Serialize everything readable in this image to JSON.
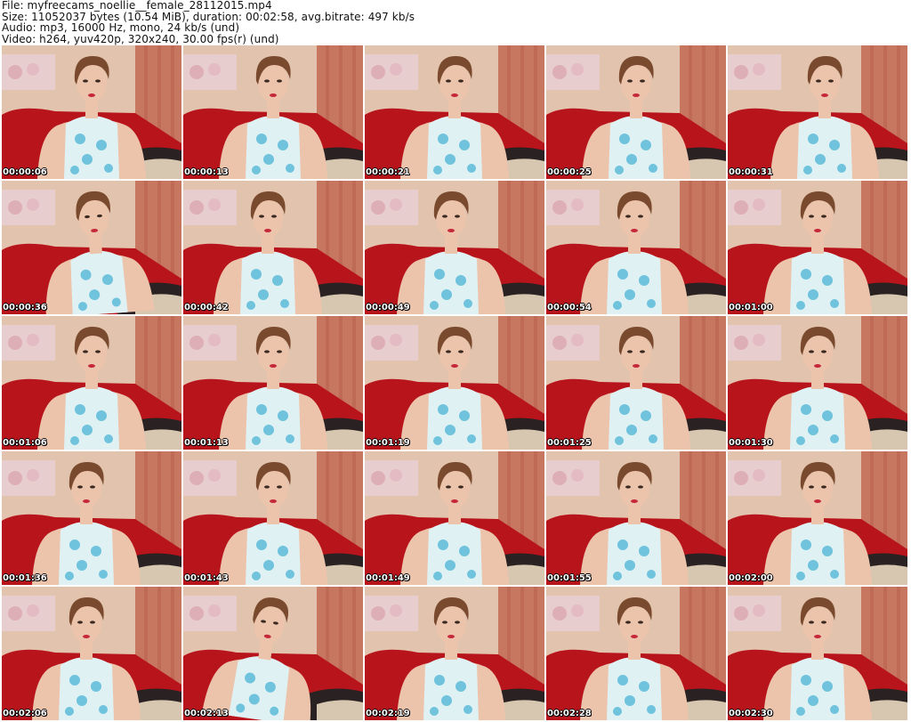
{
  "info": {
    "file_line": "File: myfreecams_noellie__female_28112015.mp4",
    "size_line": "Size: 11052037 bytes (10.54 MiB), duration: 00:02:58, avg.bitrate: 497 kb/s",
    "audio_line": "Audio: mp3, 16000 Hz, mono, 24 kb/s (und)",
    "video_line": "Video: h264, yuv420p, 320x240, 30.00 fps(r) (und)"
  },
  "colors": {
    "wall": "#e2c3ad",
    "curtain": "#c7765f",
    "sofa": "#b8141c",
    "skin": "#ecc4ac",
    "hair": "#7a4a2e",
    "dress": "#dff1f3",
    "dress_pattern": "#49b3d6"
  },
  "frames": [
    {
      "timestamp": "00:00:06"
    },
    {
      "timestamp": "00:00:13"
    },
    {
      "timestamp": "00:00:21"
    },
    {
      "timestamp": "00:00:25"
    },
    {
      "timestamp": "00:00:31"
    },
    {
      "timestamp": "00:00:36"
    },
    {
      "timestamp": "00:00:42"
    },
    {
      "timestamp": "00:00:49"
    },
    {
      "timestamp": "00:00:54"
    },
    {
      "timestamp": "00:01:00"
    },
    {
      "timestamp": "00:01:06"
    },
    {
      "timestamp": "00:01:13"
    },
    {
      "timestamp": "00:01:19"
    },
    {
      "timestamp": "00:01:25"
    },
    {
      "timestamp": "00:01:30"
    },
    {
      "timestamp": "00:01:36"
    },
    {
      "timestamp": "00:01:43"
    },
    {
      "timestamp": "00:01:49"
    },
    {
      "timestamp": "00:01:55"
    },
    {
      "timestamp": "00:02:00"
    },
    {
      "timestamp": "00:02:06"
    },
    {
      "timestamp": "00:02:13"
    },
    {
      "timestamp": "00:02:19"
    },
    {
      "timestamp": "00:02:28"
    },
    {
      "timestamp": "00:02:30"
    }
  ]
}
